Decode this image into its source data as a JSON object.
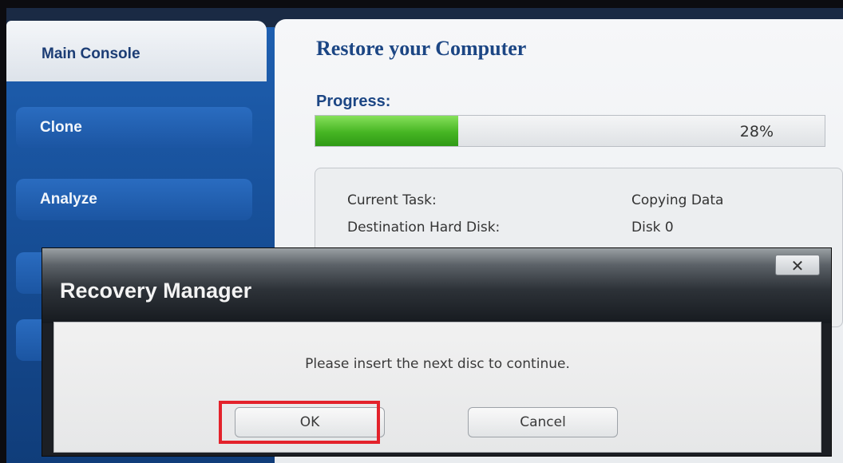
{
  "sidebar": {
    "main_tab": "Main Console",
    "items": [
      {
        "label": "Clone"
      },
      {
        "label": "Analyze"
      }
    ]
  },
  "main": {
    "title": "Restore your Computer",
    "progress": {
      "label": "Progress:",
      "percent": 28,
      "percent_text": "28%"
    },
    "details": [
      {
        "label": "Current Task:",
        "value": "Copying Data"
      },
      {
        "label": "Destination Hard Disk:",
        "value": "Disk 0"
      }
    ]
  },
  "dialog": {
    "title": "Recovery Manager",
    "close_glyph": "✕",
    "message": "Please insert the next disc to continue.",
    "ok_label": "OK",
    "cancel_label": "Cancel"
  },
  "colors": {
    "progress_fill": "#46b523",
    "highlight": "#e3222b",
    "title_blue": "#1c4684"
  }
}
